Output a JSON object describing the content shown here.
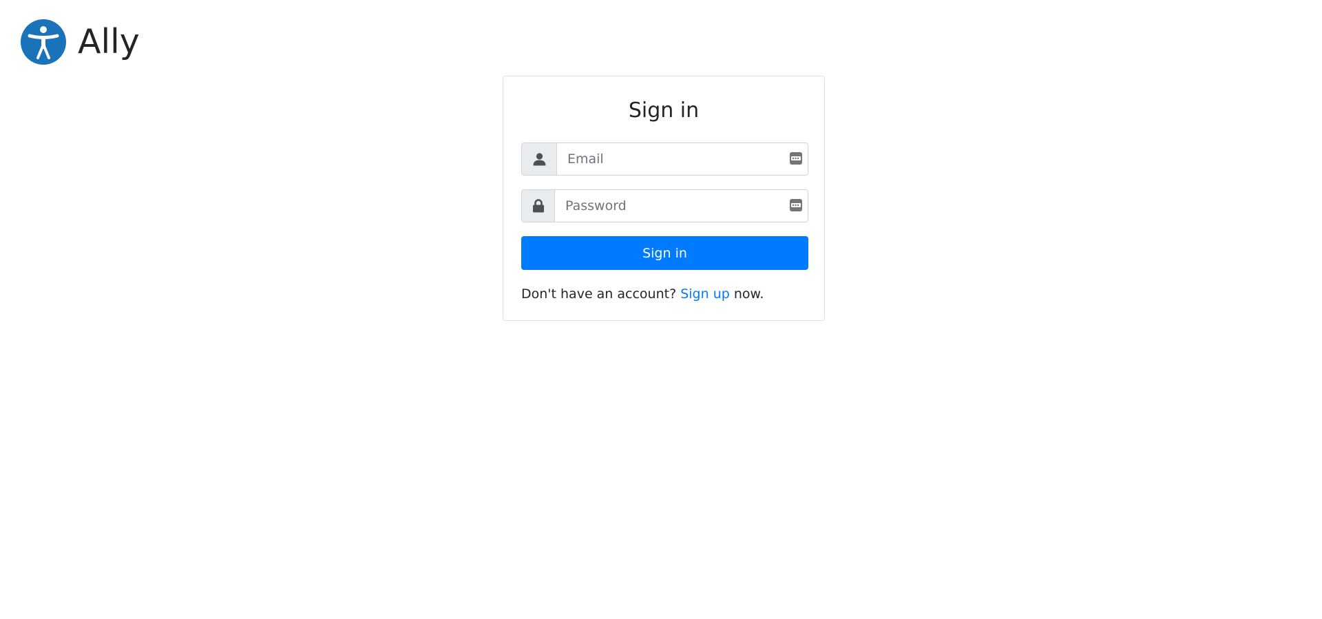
{
  "brand": {
    "name": "Ally",
    "logo_icon": "accessibility-icon",
    "logo_color": "#1a73b8"
  },
  "signin": {
    "title": "Sign in",
    "email": {
      "placeholder": "Email",
      "value": "",
      "icon": "user-icon"
    },
    "password": {
      "placeholder": "Password",
      "value": "",
      "icon": "lock-icon"
    },
    "submit_label": "Sign in",
    "signup_prompt": "Don't have an account?",
    "signup_link": "Sign up",
    "signup_suffix": "now.",
    "accent_color": "#007bff"
  }
}
